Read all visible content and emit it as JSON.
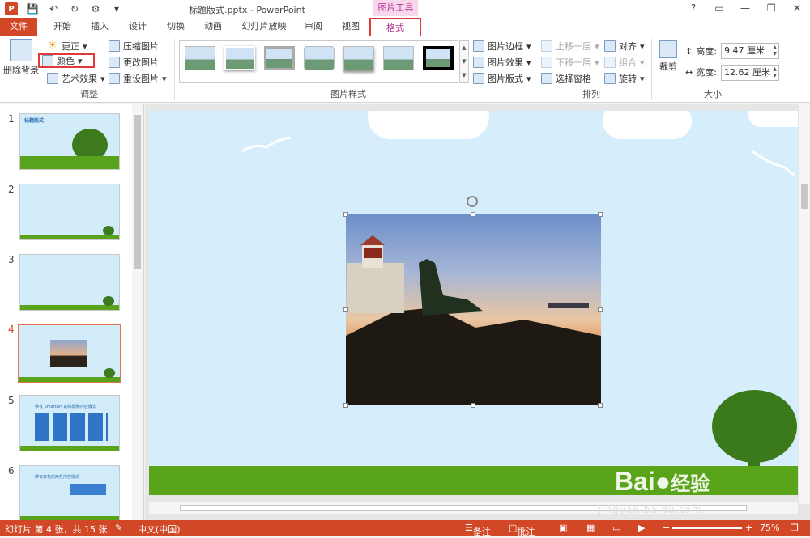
{
  "window": {
    "title": "标题版式.pptx - PowerPoint",
    "context_header": "图片工具",
    "quick_access": [
      "save-icon",
      "undo-icon",
      "redo-icon",
      "present-icon"
    ]
  },
  "tabs": [
    "文件",
    "开始",
    "插入",
    "设计",
    "切换",
    "动画",
    "幻灯片放映",
    "审阅",
    "视图",
    "格式"
  ],
  "ribbon": {
    "adjust": {
      "remove_bg": "删除背景",
      "corrections": "更正",
      "color": "颜色",
      "artistic": "艺术效果",
      "compress": "压缩图片",
      "change": "更改图片",
      "reset": "重设图片",
      "label": "调整"
    },
    "styles": {
      "label": "图片样式",
      "border": "图片边框",
      "effects": "图片效果",
      "layout": "图片版式"
    },
    "arrange": {
      "label": "排列",
      "forward": "上移一层",
      "backward": "下移一层",
      "selection": "选择窗格",
      "align": "对齐",
      "group": "组合",
      "rotate": "旋转"
    },
    "size": {
      "label": "大小",
      "crop": "裁剪",
      "height_label": "高度:",
      "height_value": "9.47 厘米",
      "width_label": "宽度:",
      "width_value": "12.62 厘米"
    }
  },
  "slides": [
    {
      "num": "1",
      "title": "标题版式"
    },
    {
      "num": "2",
      "title": ""
    },
    {
      "num": "3",
      "title": ""
    },
    {
      "num": "4",
      "title": ""
    },
    {
      "num": "5",
      "title": "带有 SmartArt 的标题和内容版式"
    },
    {
      "num": "6",
      "title": "带有表格的两栏内容版式"
    }
  ],
  "statusbar": {
    "slide_info": "幻灯片 第 4 张，共 15 张",
    "language": "中文(中国)",
    "notes": "备注",
    "comments": "批注",
    "zoom": "75%"
  },
  "watermark": {
    "brand": "Bai",
    "brand2": "经验",
    "url": "jingyan.baidu.com"
  }
}
